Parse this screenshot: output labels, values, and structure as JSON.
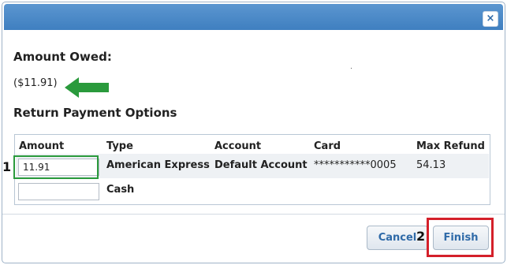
{
  "dialog": {
    "close_icon": "×"
  },
  "amount_owed": {
    "title": "Amount Owed:",
    "value": "($11.91)"
  },
  "return_options": {
    "title": "Return Payment Options",
    "columns": [
      "Amount",
      "Type",
      "Account",
      "Card",
      "Max Refund"
    ],
    "rows": [
      {
        "amount": "11.91",
        "type": "American Express",
        "account": "Default Account",
        "card": "***********0005",
        "max_refund": "54.13"
      },
      {
        "amount": "",
        "type": "Cash",
        "account": "",
        "card": "",
        "max_refund": ""
      }
    ]
  },
  "annotations": {
    "step1": "1",
    "step2": "2"
  },
  "footer": {
    "cancel_label": "Cancel",
    "finish_label": "Finish"
  },
  "colors": {
    "titlebar": "#4a88c8",
    "highlight_green": "#2a9a3c",
    "highlight_red": "#d4202a",
    "button_text": "#2f6aa8"
  }
}
